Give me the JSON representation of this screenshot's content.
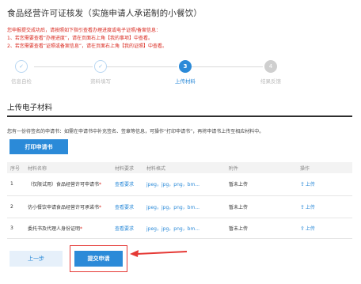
{
  "page": {
    "title": "食品经营许可证核发（实施申请人承诺制的小餐饮）"
  },
  "notice": {
    "line1": "您申报提交成功后，请按照如下指引查看办理进度或电子证照/备案信息：",
    "line2": "1、若您需要查看“办理进度”，请在页面右上角【我的事项】中查看。",
    "line3": "2、若您需要查看“证照或备案信息”，请在页面右上角【我的证照】中查看。"
  },
  "steps": [
    {
      "number": "✓",
      "label": "信息自检",
      "state": "done"
    },
    {
      "number": "✓",
      "label": "资料填写",
      "state": "done"
    },
    {
      "number": "3",
      "label": "上传材料",
      "state": "active"
    },
    {
      "number": "4",
      "label": "结果反馈",
      "state": "todo"
    }
  ],
  "section": {
    "title": "上传电子材料",
    "hint": "您有一份待签名的申请书：如需在申请书中补充签名、签章等信息，可操作“打印申请书”，再将申请书上传至相应材料中。",
    "print_button": "打印申请书"
  },
  "table": {
    "headers": [
      "序号",
      "材料名称",
      "材料要求",
      "材料格式",
      "附件",
      "操作"
    ],
    "rows": [
      {
        "index": "1",
        "name": "（仅限试用）食品经营许可申请书",
        "required": "*",
        "requirement": "查看要求",
        "formats": "jpeg，jpg，png，bm...",
        "attachment": "暂未上传",
        "action": "上传"
      },
      {
        "index": "2",
        "name": "仿小餐饮申请食品经营许可承诺书",
        "required": "*",
        "requirement": "查看要求",
        "formats": "jpeg，jpg，png，bm...",
        "attachment": "暂未上传",
        "action": "上传"
      },
      {
        "index": "3",
        "name": "委托书及代理人身份证明",
        "required": "*",
        "requirement": "查看要求",
        "formats": "jpeg，jpg，png，bm...",
        "attachment": "暂未上传",
        "action": "上传"
      }
    ]
  },
  "footer": {
    "prev_button": "上一步",
    "submit_button": "提交申请"
  },
  "colors": {
    "accent": "#2b8ad8",
    "warning": "#d9261c",
    "annotation": "#e53935"
  },
  "icons": {
    "check": "check-icon",
    "upload": "upload-icon",
    "arrow": "annotation-arrow"
  }
}
